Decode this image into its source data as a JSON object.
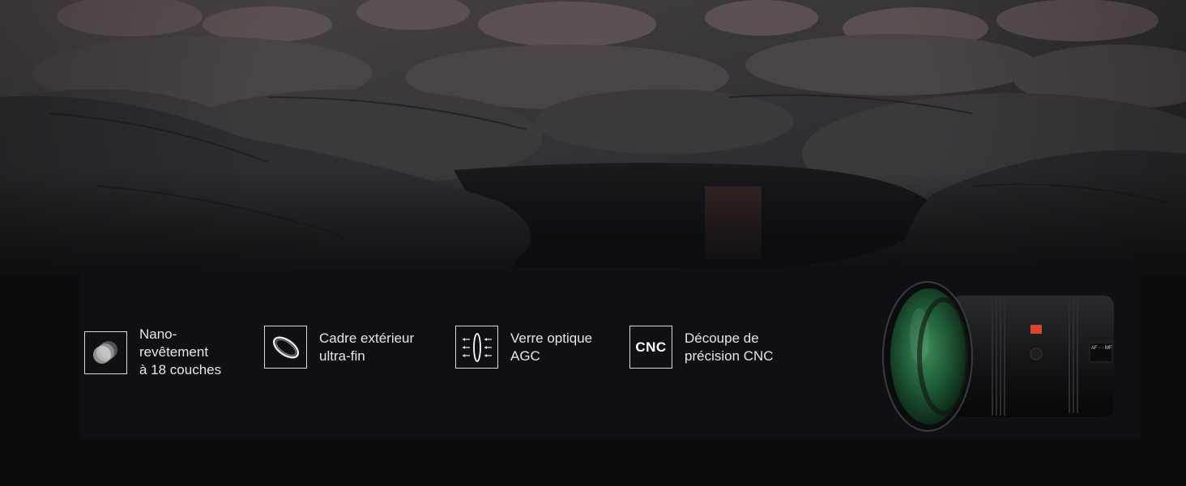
{
  "features": [
    {
      "icon": "nano-coating-icon",
      "label": "Nano-\nrevêtement\nà 18 couches"
    },
    {
      "icon": "thin-frame-ring-icon",
      "label": "Cadre extérieur\nultra-fin"
    },
    {
      "icon": "optical-glass-icon",
      "label": "Verre optique\nAGC"
    },
    {
      "icon": "cnc-icon",
      "icon_text": "CNC",
      "label": "Découpe de\nprécision CNC"
    }
  ],
  "lens": {
    "mode_label": "AF ◦ ◦ MF"
  },
  "colors": {
    "background": "#0b0c0e",
    "panel": "#0f1013",
    "accent_filter_green": "#1f6b3a",
    "lens_button": "#d9462b"
  }
}
